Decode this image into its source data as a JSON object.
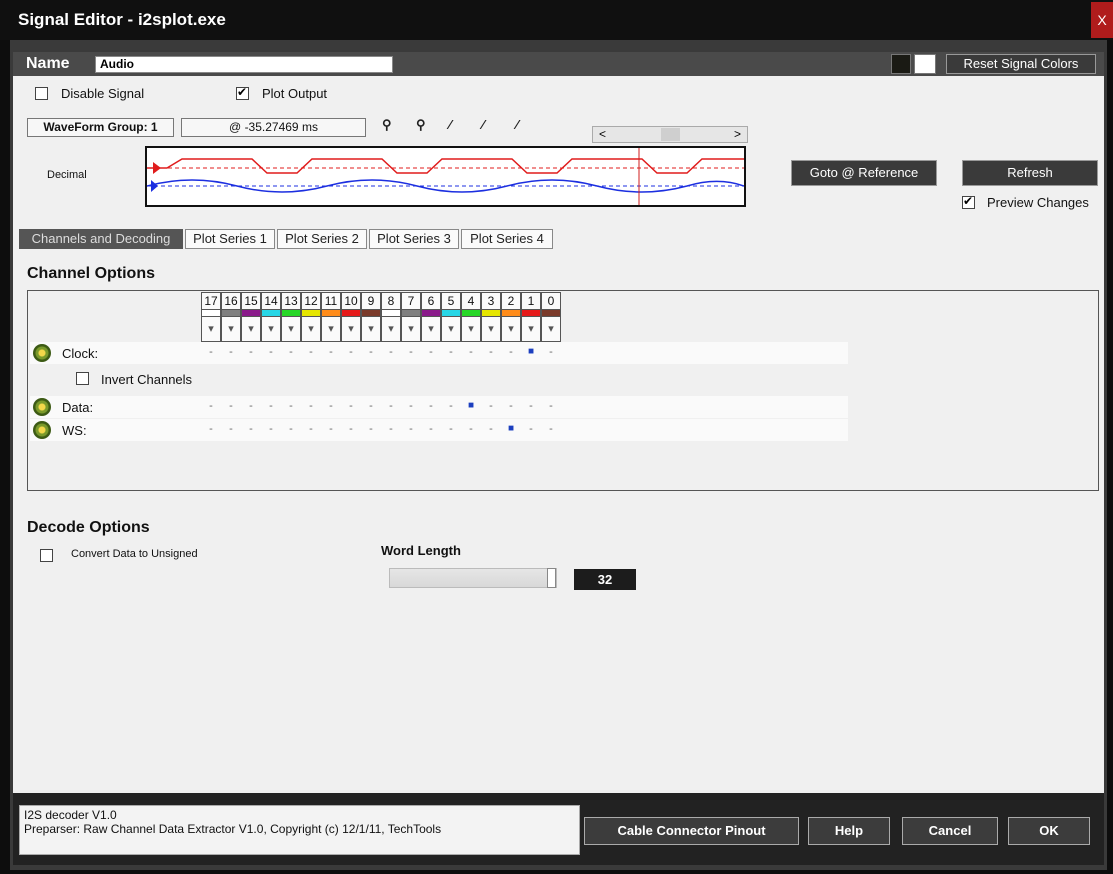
{
  "window": {
    "title": "Signal Editor - i2splot.exe",
    "close_label": "X"
  },
  "name_bar": {
    "label": "Name",
    "value": "Audio",
    "reset_colors_label": "Reset Signal Colors"
  },
  "options": {
    "disable_signal": "Disable Signal",
    "plot_output": "Plot Output",
    "disable_checked": false,
    "plot_checked": true
  },
  "waveform": {
    "group_label": "WaveForm Group: 1",
    "position": "@ -35.27469 ms",
    "format": "Decimal"
  },
  "buttons": {
    "goto_reference": "Goto @ Reference",
    "refresh": "Refresh",
    "preview_changes": "Preview Changes"
  },
  "tabs": [
    "Channels and Decoding",
    "Plot Series 1",
    "Plot Series 2",
    "Plot Series 3",
    "Plot Series 4"
  ],
  "channel_options": {
    "title": "Channel Options",
    "bit_headers": [
      "17",
      "16",
      "15",
      "14",
      "13",
      "12",
      "11",
      "10",
      "9",
      "8",
      "7",
      "6",
      "5",
      "4",
      "3",
      "2",
      "1",
      "0"
    ],
    "bit_colors": [
      "#ffffff",
      "#7f7f7f",
      "#8a1a8a",
      "#26d6e6",
      "#26d626",
      "#e6e600",
      "#ff8c1a",
      "#e61a1a",
      "#7a3a2a",
      "#ffffff",
      "#7f7f7f",
      "#8a1a8a",
      "#26d6e6",
      "#26d626",
      "#e6e600",
      "#ff8c1a",
      "#e61a1a",
      "#7a3a2a"
    ],
    "rows": [
      {
        "label": "Clock:",
        "selected_bit": "1"
      },
      {
        "label": "Data:",
        "selected_bit": "4"
      },
      {
        "label": "WS:",
        "selected_bit": "2"
      }
    ],
    "invert_channels": "Invert Channels",
    "bit_mark": "-",
    "selected_mark": "■"
  },
  "decode_options": {
    "title": "Decode Options",
    "convert_unsigned": "Convert Data to Unsigned",
    "word_length_label": "Word Length",
    "word_length_value": "32",
    "word_length_fraction": 1.0
  },
  "footer": {
    "info_line1": "I2S decoder V1.0",
    "info_line2": "Preparser: Raw Channel Data Extractor V1.0, Copyright (c) 12/1/11, TechTools",
    "cable_label": "Cable Connector Pinout",
    "help_label": "Help",
    "cancel_label": "Cancel",
    "ok_label": "OK"
  },
  "colors": {
    "wave_red": "#e01c1c",
    "wave_blue": "#1c2fe0",
    "cursor": "#d01c1c"
  }
}
